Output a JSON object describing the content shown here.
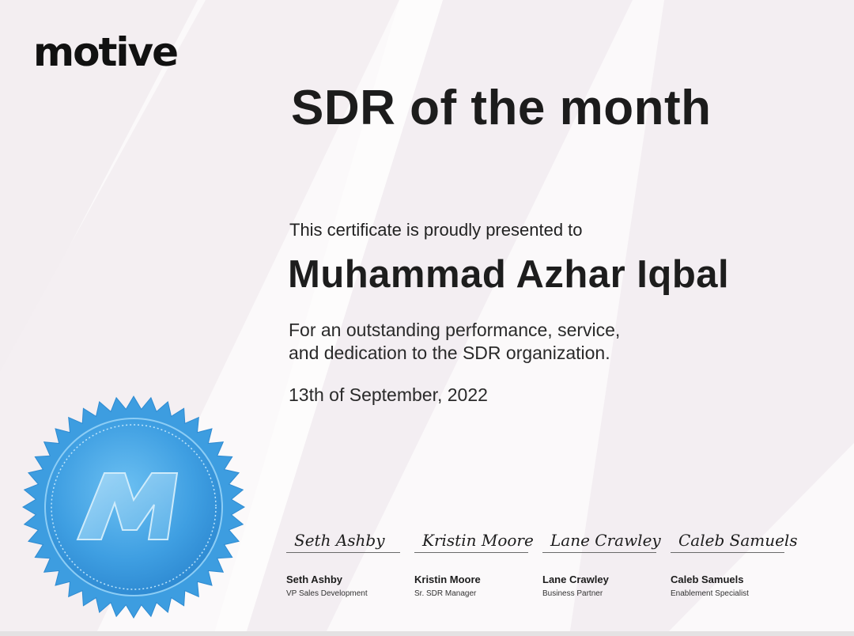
{
  "brand": {
    "logo_text": "motive"
  },
  "certificate": {
    "title": "SDR of the month",
    "presented_text": "This certificate is proudly presented to",
    "recipient": "Muhammad Azhar Iqbal",
    "reason_line1": "For an outstanding performance, service,",
    "reason_line2": "and dedication to the SDR organization.",
    "date": "13th of September, 2022"
  },
  "seal": {
    "letter": "M",
    "color": "#4aa6e6",
    "emblem": "seal-badge-icon"
  },
  "signatures": [
    {
      "script": "Seth Ashby",
      "name": "Seth Ashby",
      "role": "VP Sales Development"
    },
    {
      "script": "Kristin Moore",
      "name": "Kristin Moore",
      "role": "Sr. SDR Manager"
    },
    {
      "script": "Lane Crawley",
      "name": "Lane Crawley",
      "role": "Business Partner"
    },
    {
      "script": "Caleb Samuels",
      "name": "Caleb Samuels",
      "role": "Enablement Specialist"
    }
  ],
  "colors": {
    "background": "#fbf9fa",
    "stripe": "#f1ebef",
    "text": "#1c1c1c",
    "seal_blue": "#4aa6e6"
  }
}
